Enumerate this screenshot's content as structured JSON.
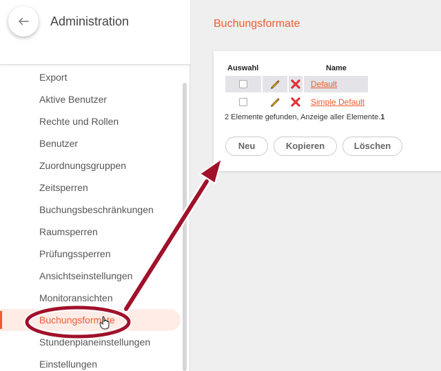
{
  "sidebar": {
    "title": "Administration",
    "back_icon": "arrow-left-icon",
    "items": [
      {
        "label": "Export"
      },
      {
        "label": "Aktive Benutzer"
      },
      {
        "label": "Rechte und Rollen"
      },
      {
        "label": "Benutzer"
      },
      {
        "label": "Zuordnungsgruppen"
      },
      {
        "label": "Zeitsperren"
      },
      {
        "label": "Buchungsbeschränkungen"
      },
      {
        "label": "Raumsperren"
      },
      {
        "label": "Prüfungssperren"
      },
      {
        "label": "Ansichtseinstellungen"
      },
      {
        "label": "Monitoransichten"
      },
      {
        "label": "Buchungsformate",
        "active": true
      },
      {
        "label": "Stundenplaneinstellungen"
      },
      {
        "label": "Einstellungen"
      }
    ]
  },
  "main": {
    "title": "Buchungsformate",
    "table": {
      "headers": {
        "select": "Auswahl",
        "name": "Name"
      },
      "rows": [
        {
          "name": "Default"
        },
        {
          "name": "Simple Default"
        }
      ]
    },
    "summary": "2 Elemente gefunden, Anzeige aller Elemente.",
    "page": "1",
    "buttons": {
      "new": "Neu",
      "copy": "Kopieren",
      "delete": "Löschen"
    }
  },
  "colors": {
    "accent": "#ef5a2f",
    "annotation": "#a0112a",
    "row_highlight": "#e3e3e8"
  },
  "icons": {
    "edit": "pencil-icon",
    "delete": "delete-x-icon",
    "cursor": "hand-pointer-icon"
  }
}
